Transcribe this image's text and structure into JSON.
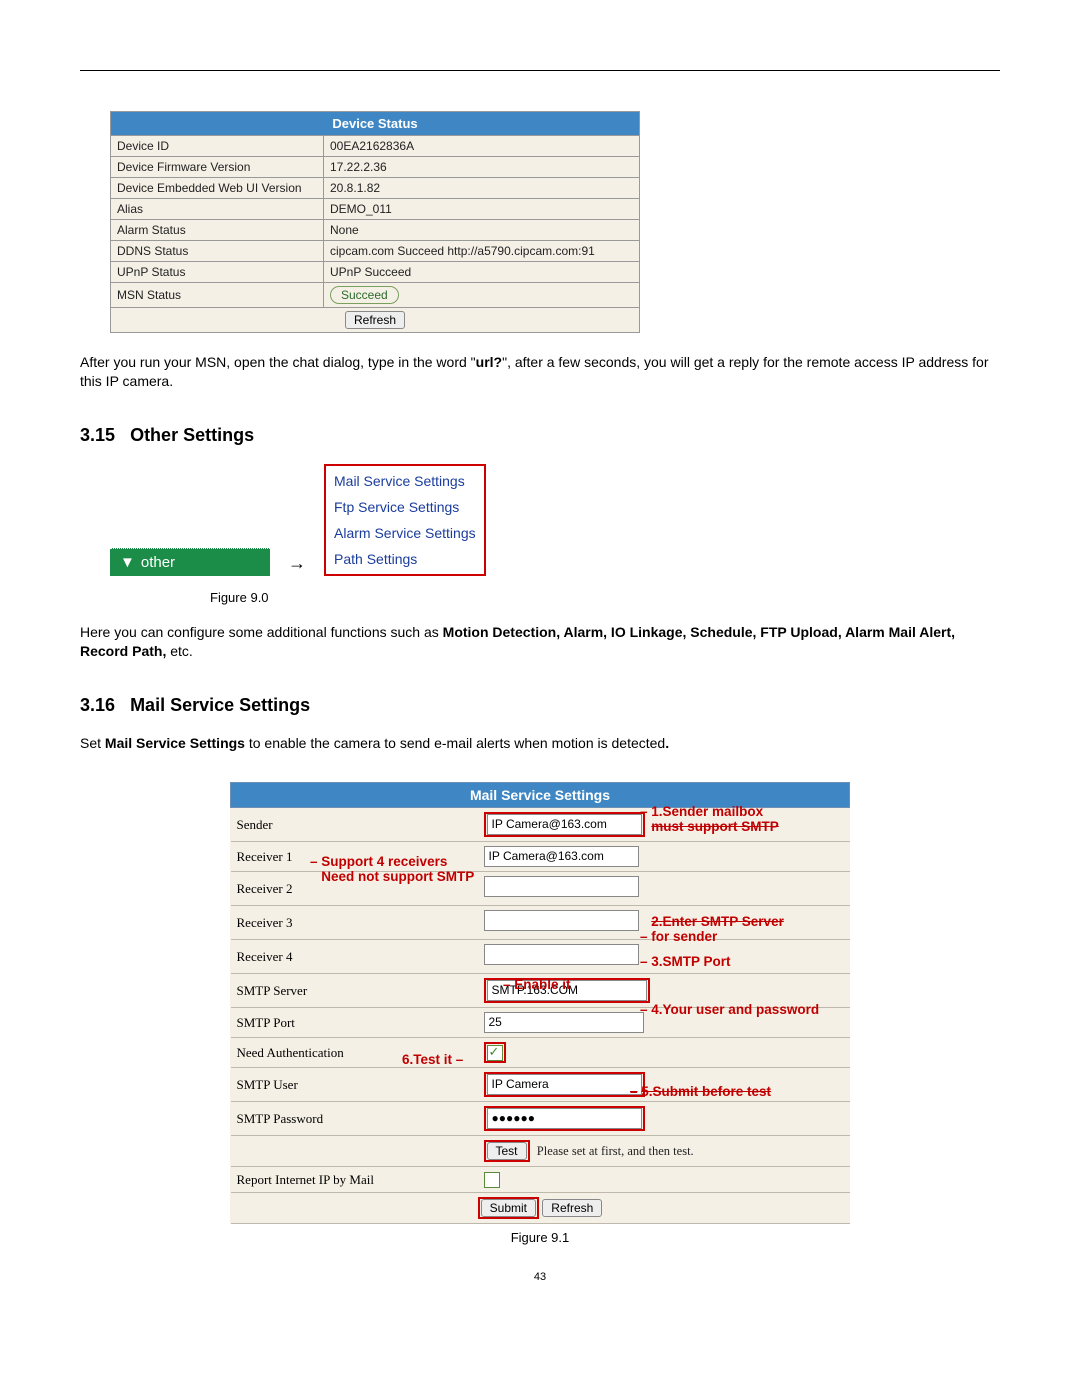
{
  "page_number": "43",
  "intro_para": "After you run your MSN, open the chat dialog, type in the word \"",
  "intro_bold": "url?",
  "intro_para2": "\", after a few seconds, you will get a reply for the remote access IP address for this IP camera.",
  "status_table": {
    "title": "Device Status",
    "rows": [
      {
        "label": "Device ID",
        "value": "00EA2162836A"
      },
      {
        "label": "Device Firmware Version",
        "value": "17.22.2.36"
      },
      {
        "label": "Device Embedded Web UI Version",
        "value": "20.8.1.82"
      },
      {
        "label": "Alias",
        "value": "DEMO_011"
      },
      {
        "label": "Alarm Status",
        "value": "None"
      },
      {
        "label": "DDNS Status",
        "value": "cipcam.com  Succeed  http://a5790.cipcam.com:91"
      },
      {
        "label": "UPnP Status",
        "value": "UPnP Succeed"
      },
      {
        "label": "MSN Status",
        "value": "Succeed",
        "oval": true
      }
    ],
    "refresh": "Refresh"
  },
  "section_315": {
    "num": "3.15",
    "title": "Other Settings",
    "tab_label": "other",
    "arrow": "→",
    "services": [
      "Mail Service Settings",
      "Ftp Service Settings",
      "Alarm Service Settings",
      "Path Settings"
    ],
    "figure_caption": "Figure 9.0",
    "body_pre": "Here you can configure some additional functions such as ",
    "body_bold": "Motion Detection, Alarm, IO Linkage, Schedule, FTP Upload, Alarm Mail Alert, Record Path,",
    "body_post": " etc."
  },
  "section_316": {
    "num": "3.16",
    "title": "Mail Service Settings",
    "body_pre": "Set ",
    "body_bold": "Mail Service Settings",
    "body_post": " to enable the camera to send e-mail alerts when motion is detected",
    "body_end": "."
  },
  "mail_table": {
    "title": "Mail Service Settings",
    "rows": {
      "sender": {
        "label": "Sender",
        "value": "IP Camera@163.com"
      },
      "r1": {
        "label": "Receiver 1",
        "value": "IP Camera@163.com"
      },
      "r2": {
        "label": "Receiver 2",
        "value": ""
      },
      "r3": {
        "label": "Receiver 3",
        "value": ""
      },
      "r4": {
        "label": "Receiver 4",
        "value": ""
      },
      "smtp_server": {
        "label": "SMTP Server",
        "value": "SMTP.163.COM"
      },
      "smtp_port": {
        "label": "SMTP Port",
        "value": "25"
      },
      "need_auth": {
        "label": "Need Authentication",
        "checked": true
      },
      "smtp_user": {
        "label": "SMTP User",
        "value": "IP Camera"
      },
      "smtp_pass": {
        "label": "SMTP Password",
        "value": "●●●●●●"
      },
      "test": {
        "btn": "Test",
        "hint": "Please set at first, and then test."
      },
      "report": {
        "label": "Report Internet IP by Mail",
        "checked": false
      },
      "submit": "Submit",
      "refresh": "Refresh"
    },
    "figure_caption": "Figure 9.1"
  },
  "annotations": {
    "a1a": "1.Sender mailbox",
    "a1b": "must support SMTP",
    "a_recv": "Support 4 receivers",
    "a_recv2": "Need not support SMTP",
    "a2a": "2.Enter SMTP Server",
    "a2b": "for sender",
    "a3": "3.SMTP Port",
    "a_enable": "Enable it",
    "a4": "4.Your user and password",
    "a6": "6.Test it",
    "a5": "5.Submit before test"
  }
}
